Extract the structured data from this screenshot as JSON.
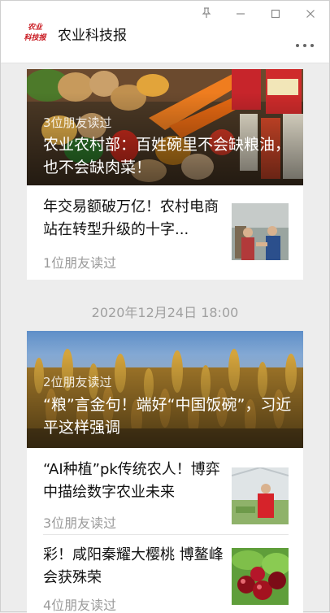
{
  "app": {
    "title": "农业科技报",
    "logo_text": "农业科技报",
    "window_controls": [
      "pin-icon",
      "minimize-icon",
      "maximize-icon",
      "close-icon"
    ],
    "more_icon": "more-icon"
  },
  "groups": [
    {
      "hero": {
        "reads": "3位朋友读过",
        "title": "农业农村部：百姓碗里不会缺粮油，也不会缺肉菜！"
      },
      "items": [
        {
          "title": "年交易额破万亿！农村电商站在转型升级的十字...",
          "reads": "1位朋友读过"
        }
      ]
    },
    {
      "date": "2020年12月24日 18:00",
      "hero": {
        "reads": "2位朋友读过",
        "title": "“粮”言金句！端好“中国饭碗”，习近平这样强调"
      },
      "items": [
        {
          "title": "“AI种植”pk传统农人！博弈中描绘数字农业未来",
          "reads": "3位朋友读过"
        },
        {
          "title": "彩！咸阳秦耀大樱桃 博鳌峰会获殊荣",
          "reads": "4位朋友读过"
        }
      ]
    }
  ],
  "colors": {
    "background": "#ededed",
    "card": "#ffffff",
    "meta_text": "#9a9a9a",
    "logo_red": "#c8161d"
  }
}
